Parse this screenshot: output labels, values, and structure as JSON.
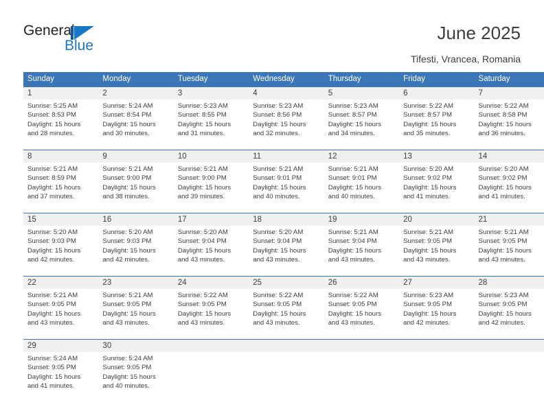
{
  "brand": {
    "name_part1": "General",
    "name_part2": "Blue",
    "mark": "triangle-logo-icon",
    "color_dark": "#231f20",
    "color_blue": "#1878c8"
  },
  "header": {
    "title": "June 2025",
    "subtitle": "Tifesti, Vrancea, Romania"
  },
  "theme": {
    "header_blue": "#3a76b8",
    "daynum_band": "#f0f0f0",
    "text": "#3d3d3d"
  },
  "calendar": {
    "weekday_headers": [
      "Sunday",
      "Monday",
      "Tuesday",
      "Wednesday",
      "Thursday",
      "Friday",
      "Saturday"
    ],
    "weeks": [
      {
        "days": [
          {
            "num": "1",
            "sunrise": "Sunrise: 5:25 AM",
            "sunset": "Sunset: 8:53 PM",
            "daylight_1": "Daylight: 15 hours",
            "daylight_2": "and 28 minutes."
          },
          {
            "num": "2",
            "sunrise": "Sunrise: 5:24 AM",
            "sunset": "Sunset: 8:54 PM",
            "daylight_1": "Daylight: 15 hours",
            "daylight_2": "and 30 minutes."
          },
          {
            "num": "3",
            "sunrise": "Sunrise: 5:23 AM",
            "sunset": "Sunset: 8:55 PM",
            "daylight_1": "Daylight: 15 hours",
            "daylight_2": "and 31 minutes."
          },
          {
            "num": "4",
            "sunrise": "Sunrise: 5:23 AM",
            "sunset": "Sunset: 8:56 PM",
            "daylight_1": "Daylight: 15 hours",
            "daylight_2": "and 32 minutes."
          },
          {
            "num": "5",
            "sunrise": "Sunrise: 5:23 AM",
            "sunset": "Sunset: 8:57 PM",
            "daylight_1": "Daylight: 15 hours",
            "daylight_2": "and 34 minutes."
          },
          {
            "num": "6",
            "sunrise": "Sunrise: 5:22 AM",
            "sunset": "Sunset: 8:57 PM",
            "daylight_1": "Daylight: 15 hours",
            "daylight_2": "and 35 minutes."
          },
          {
            "num": "7",
            "sunrise": "Sunrise: 5:22 AM",
            "sunset": "Sunset: 8:58 PM",
            "daylight_1": "Daylight: 15 hours",
            "daylight_2": "and 36 minutes."
          }
        ]
      },
      {
        "days": [
          {
            "num": "8",
            "sunrise": "Sunrise: 5:21 AM",
            "sunset": "Sunset: 8:59 PM",
            "daylight_1": "Daylight: 15 hours",
            "daylight_2": "and 37 minutes."
          },
          {
            "num": "9",
            "sunrise": "Sunrise: 5:21 AM",
            "sunset": "Sunset: 9:00 PM",
            "daylight_1": "Daylight: 15 hours",
            "daylight_2": "and 38 minutes."
          },
          {
            "num": "10",
            "sunrise": "Sunrise: 5:21 AM",
            "sunset": "Sunset: 9:00 PM",
            "daylight_1": "Daylight: 15 hours",
            "daylight_2": "and 39 minutes."
          },
          {
            "num": "11",
            "sunrise": "Sunrise: 5:21 AM",
            "sunset": "Sunset: 9:01 PM",
            "daylight_1": "Daylight: 15 hours",
            "daylight_2": "and 40 minutes."
          },
          {
            "num": "12",
            "sunrise": "Sunrise: 5:21 AM",
            "sunset": "Sunset: 9:01 PM",
            "daylight_1": "Daylight: 15 hours",
            "daylight_2": "and 40 minutes."
          },
          {
            "num": "13",
            "sunrise": "Sunrise: 5:20 AM",
            "sunset": "Sunset: 9:02 PM",
            "daylight_1": "Daylight: 15 hours",
            "daylight_2": "and 41 minutes."
          },
          {
            "num": "14",
            "sunrise": "Sunrise: 5:20 AM",
            "sunset": "Sunset: 9:02 PM",
            "daylight_1": "Daylight: 15 hours",
            "daylight_2": "and 41 minutes."
          }
        ]
      },
      {
        "days": [
          {
            "num": "15",
            "sunrise": "Sunrise: 5:20 AM",
            "sunset": "Sunset: 9:03 PM",
            "daylight_1": "Daylight: 15 hours",
            "daylight_2": "and 42 minutes."
          },
          {
            "num": "16",
            "sunrise": "Sunrise: 5:20 AM",
            "sunset": "Sunset: 9:03 PM",
            "daylight_1": "Daylight: 15 hours",
            "daylight_2": "and 42 minutes."
          },
          {
            "num": "17",
            "sunrise": "Sunrise: 5:20 AM",
            "sunset": "Sunset: 9:04 PM",
            "daylight_1": "Daylight: 15 hours",
            "daylight_2": "and 43 minutes."
          },
          {
            "num": "18",
            "sunrise": "Sunrise: 5:20 AM",
            "sunset": "Sunset: 9:04 PM",
            "daylight_1": "Daylight: 15 hours",
            "daylight_2": "and 43 minutes."
          },
          {
            "num": "19",
            "sunrise": "Sunrise: 5:21 AM",
            "sunset": "Sunset: 9:04 PM",
            "daylight_1": "Daylight: 15 hours",
            "daylight_2": "and 43 minutes."
          },
          {
            "num": "20",
            "sunrise": "Sunrise: 5:21 AM",
            "sunset": "Sunset: 9:05 PM",
            "daylight_1": "Daylight: 15 hours",
            "daylight_2": "and 43 minutes."
          },
          {
            "num": "21",
            "sunrise": "Sunrise: 5:21 AM",
            "sunset": "Sunset: 9:05 PM",
            "daylight_1": "Daylight: 15 hours",
            "daylight_2": "and 43 minutes."
          }
        ]
      },
      {
        "days": [
          {
            "num": "22",
            "sunrise": "Sunrise: 5:21 AM",
            "sunset": "Sunset: 9:05 PM",
            "daylight_1": "Daylight: 15 hours",
            "daylight_2": "and 43 minutes."
          },
          {
            "num": "23",
            "sunrise": "Sunrise: 5:21 AM",
            "sunset": "Sunset: 9:05 PM",
            "daylight_1": "Daylight: 15 hours",
            "daylight_2": "and 43 minutes."
          },
          {
            "num": "24",
            "sunrise": "Sunrise: 5:22 AM",
            "sunset": "Sunset: 9:05 PM",
            "daylight_1": "Daylight: 15 hours",
            "daylight_2": "and 43 minutes."
          },
          {
            "num": "25",
            "sunrise": "Sunrise: 5:22 AM",
            "sunset": "Sunset: 9:05 PM",
            "daylight_1": "Daylight: 15 hours",
            "daylight_2": "and 43 minutes."
          },
          {
            "num": "26",
            "sunrise": "Sunrise: 5:22 AM",
            "sunset": "Sunset: 9:05 PM",
            "daylight_1": "Daylight: 15 hours",
            "daylight_2": "and 43 minutes."
          },
          {
            "num": "27",
            "sunrise": "Sunrise: 5:23 AM",
            "sunset": "Sunset: 9:05 PM",
            "daylight_1": "Daylight: 15 hours",
            "daylight_2": "and 42 minutes."
          },
          {
            "num": "28",
            "sunrise": "Sunrise: 5:23 AM",
            "sunset": "Sunset: 9:05 PM",
            "daylight_1": "Daylight: 15 hours",
            "daylight_2": "and 42 minutes."
          }
        ]
      },
      {
        "days": [
          {
            "num": "29",
            "sunrise": "Sunrise: 5:24 AM",
            "sunset": "Sunset: 9:05 PM",
            "daylight_1": "Daylight: 15 hours",
            "daylight_2": "and 41 minutes."
          },
          {
            "num": "30",
            "sunrise": "Sunrise: 5:24 AM",
            "sunset": "Sunset: 9:05 PM",
            "daylight_1": "Daylight: 15 hours",
            "daylight_2": "and 40 minutes."
          },
          {
            "num": "",
            "sunrise": "",
            "sunset": "",
            "daylight_1": "",
            "daylight_2": ""
          },
          {
            "num": "",
            "sunrise": "",
            "sunset": "",
            "daylight_1": "",
            "daylight_2": ""
          },
          {
            "num": "",
            "sunrise": "",
            "sunset": "",
            "daylight_1": "",
            "daylight_2": ""
          },
          {
            "num": "",
            "sunrise": "",
            "sunset": "",
            "daylight_1": "",
            "daylight_2": ""
          },
          {
            "num": "",
            "sunrise": "",
            "sunset": "",
            "daylight_1": "",
            "daylight_2": ""
          }
        ]
      }
    ]
  }
}
